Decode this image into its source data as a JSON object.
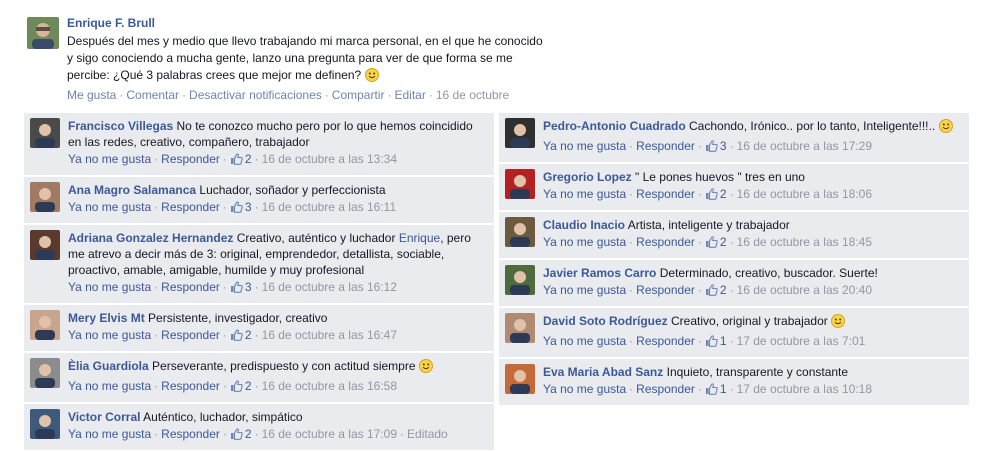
{
  "post": {
    "author": "Enrique F. Brull",
    "text": "Después del mes y medio que llevo trabajando mi marca personal, en el que he conocido y sigo conociendo a mucha gente, lanzo una pregunta para ver de que forma se me percibe: ¿Qué 3 palabras crees que mejor me definen?",
    "actions": [
      "Me gusta",
      "Comentar",
      "Desactivar notificaciones",
      "Compartir",
      "Editar"
    ],
    "date": "16 de octubre"
  },
  "comment_actions": {
    "unlike": "Ya no me gusta",
    "reply": "Responder"
  },
  "left_comments": [
    {
      "name": "Francisco Villegas",
      "text": "No te conozco mucho pero por lo que hemos coincidido en las redes, creativo, compañero, trabajador",
      "likes": "2",
      "time": "16 de octubre a las 13:34",
      "avatar_color": "#4a4a4a"
    },
    {
      "name": "Ana Magro Salamanca",
      "text": "Luchador, soñador y perfeccionista",
      "likes": "3",
      "time": "16 de octubre a las 16:11",
      "avatar_color": "#a07a63"
    },
    {
      "name": "Adriana Gonzalez Hernandez",
      "text_before": "Creativo, auténtico y luchador",
      "mention": "Enrique",
      "text_after": ", pero me atrevo a decir más de 3: original, emprendedor, detallista, sociable, proactivo, amable, amigable, humilde y muy profesional",
      "likes": "3",
      "time": "16 de octubre a las 16:12",
      "avatar_color": "#5b3a2e"
    },
    {
      "name": "Mery Elvis Mt",
      "text": "Persistente, investigador, creativo",
      "likes": "2",
      "time": "16 de octubre a las 16:47",
      "avatar_color": "#c9a58d"
    },
    {
      "name": "Èlia Guardiola",
      "text": "Perseverante, predispuesto y con actitud siempre",
      "likes": "2",
      "time": "16 de octubre a las 16:58",
      "avatar_color": "#8c8c8c"
    },
    {
      "name": "Victor Corral",
      "text": "Auténtico, luchador, simpático",
      "likes": "2",
      "time": "16 de octubre a las 17:09",
      "edited": "Editado",
      "avatar_color": "#3d5a7a"
    }
  ],
  "right_comments": [
    {
      "name": "Pedro-Antonio Cuadrado",
      "text": "Cachondo, Irónico.. por lo tanto, Inteligente!!!..",
      "likes": "3",
      "time": "16 de octubre a las 17:29",
      "avatar_color": "#2f2f2f"
    },
    {
      "name": "Gregorio Lopez",
      "text": "\" Le pones huevos \" tres en uno",
      "likes": "2",
      "time": "16 de octubre a las 18:06",
      "avatar_color": "#b32222"
    },
    {
      "name": "Claudio Inacio",
      "text": "Artista, inteligente y trabajador",
      "likes": "2",
      "time": "16 de octubre a las 18:45",
      "avatar_color": "#6b5a3e"
    },
    {
      "name": "Javier Ramos Carro",
      "text": "Determinado, creativo, buscador. Suerte!",
      "likes": "2",
      "time": "16 de octubre a las 20:40",
      "avatar_color": "#4d6b3c"
    },
    {
      "name": "David Soto Rodríguez",
      "text": "Creativo, original y trabajador",
      "likes": "1",
      "time": "17 de octubre a las 7:01",
      "avatar_color": "#b08a72"
    },
    {
      "name": "Eva Maria Abad Sanz",
      "text": "Inquieto, transparente y constante",
      "likes": "1",
      "time": "17 de octubre a las 10:18",
      "avatar_color": "#c46a3a"
    }
  ],
  "colors": {
    "link": "#3b5998",
    "comment_bg": "#e9ebee",
    "meta": "#9197a3"
  }
}
